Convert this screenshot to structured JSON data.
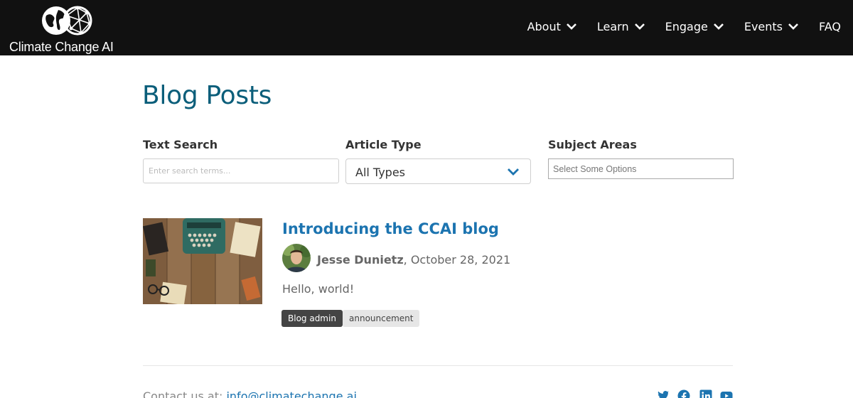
{
  "header": {
    "brand": "Climate Change AI",
    "nav": [
      {
        "label": "About",
        "has_dropdown": true
      },
      {
        "label": "Learn",
        "has_dropdown": true
      },
      {
        "label": "Engage",
        "has_dropdown": true
      },
      {
        "label": "Events",
        "has_dropdown": true
      },
      {
        "label": "FAQ",
        "has_dropdown": false
      }
    ]
  },
  "main": {
    "title": "Blog Posts",
    "filters": {
      "text_search": {
        "label": "Text Search",
        "placeholder": "Enter search terms...",
        "value": ""
      },
      "article_type": {
        "label": "Article Type",
        "selected": "All Types"
      },
      "subject_areas": {
        "label": "Subject Areas",
        "placeholder": "Select Some Options"
      }
    },
    "posts": [
      {
        "title": "Introducing the CCAI blog",
        "author": "Jesse Dunietz",
        "date_sep": ", ",
        "date": "October 28, 2021",
        "excerpt": "Hello, world!",
        "tags": [
          "Blog admin",
          "announcement"
        ]
      }
    ]
  },
  "footer": {
    "contact_prefix": "Contact us at:",
    "email": "info@climatechange.ai",
    "social": [
      "twitter-icon",
      "facebook-icon",
      "linkedin-icon",
      "youtube-icon"
    ]
  },
  "colors": {
    "header_bg": "#111111",
    "title": "#0b5e7a",
    "link": "#1c74b0",
    "tag_dark": "#444444",
    "tag_light": "#e6e6e6"
  }
}
